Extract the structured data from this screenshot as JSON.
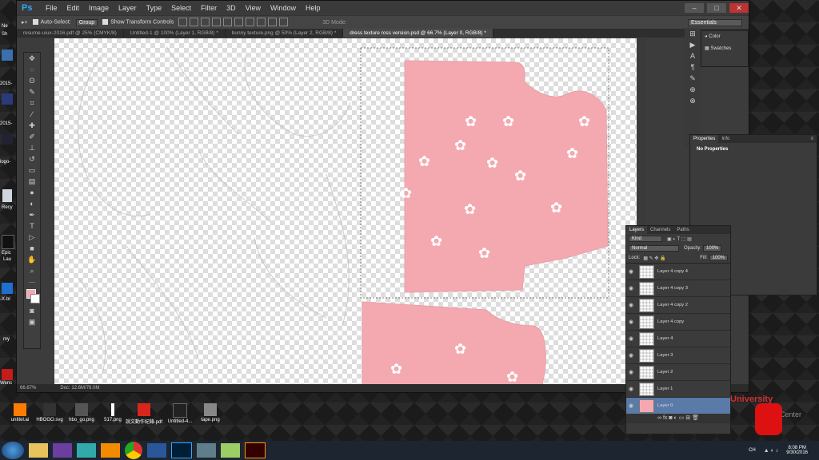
{
  "menubar": {
    "logo": "Ps",
    "items": [
      "File",
      "Edit",
      "Image",
      "Layer",
      "Type",
      "Select",
      "Filter",
      "3D",
      "View",
      "Window",
      "Help"
    ]
  },
  "options": {
    "auto_select": "Auto-Select:",
    "group": "Group",
    "show_transform": "Show Transform Controls",
    "mode_3d": "3D Mode:",
    "workspace": "Essentials"
  },
  "tabs": [
    "resume-uiux-2016.pdf @ 25% (CMYK/8)",
    "Untitled-1 @ 100% (Layer 1, RGB/8) *",
    "bunny texture.png @ 50% (Layer 2, RGB/8) *",
    "dress texture ross version.psd @ 66.7% (Layer 0, RGB/8) *"
  ],
  "status": {
    "zoom": "66.67%",
    "doc": "Doc: 12.6M/78.0M"
  },
  "color_panel": {
    "items": [
      "Color",
      "Swatches"
    ]
  },
  "properties": {
    "tabs": [
      "Properties",
      "Info"
    ],
    "text": "No Properties"
  },
  "layers": {
    "tabs": [
      "Layers",
      "Channels",
      "Paths"
    ],
    "filter": "Kind",
    "blend": "Normal",
    "opacity_label": "Opacity:",
    "opacity": "100%",
    "lock_label": "Lock:",
    "fill_label": "Fill:",
    "fill": "100%",
    "rows": [
      "Layer 4 copy 4",
      "Layer 4 copy 3",
      "Layer 4 copy 2",
      "Layer 4 copy",
      "Layer 4",
      "Layer 3",
      "Layer 2",
      "Layer 1",
      "Layer 0"
    ],
    "selected": "Layer 0"
  },
  "desktop": {
    "left_labels": [
      "Ne",
      "Sh",
      "2015-",
      "2015-",
      "logo-",
      "Recy",
      "Epic",
      "Lau",
      "-X-bl",
      "my",
      "Wenc"
    ],
    "icons": [
      {
        "label": "untitel.ai",
        "icon": "illustrator-icon",
        "color": "#ff7c00"
      },
      {
        "label": "HBOGO.svg",
        "icon": "hbogo-icon",
        "color": "#ffffff"
      },
      {
        "label": "hbo_go.png",
        "icon": "hbo-icon",
        "color": "#dddddd"
      },
      {
        "label": "517.png",
        "icon": "image-icon",
        "color": "#ffffff"
      },
      {
        "label": "說文動作紀錄.pdf",
        "icon": "pdf-icon",
        "color": "#d9261c"
      },
      {
        "label": "Untitled-4...",
        "icon": "image-icon",
        "color": "#ffffff"
      },
      {
        "label": "tape.png",
        "icon": "tape-icon",
        "color": "#888888"
      }
    ],
    "university_text": "University",
    "center_text": "Center"
  },
  "taskbar": {
    "apps": [
      "explorer",
      "folder",
      "media",
      "vlc",
      "chrome",
      "word",
      "photoshop",
      "files",
      "notes",
      "illustrator"
    ],
    "lang": "CH",
    "time": "8:08 PM",
    "date": "9/30/2016"
  }
}
